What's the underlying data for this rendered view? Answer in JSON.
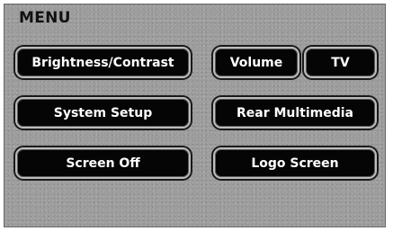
{
  "menu": {
    "title": "MENU"
  },
  "buttons": {
    "brightness_contrast": "Brightness/Contrast",
    "volume": "Volume",
    "tv": "TV",
    "system_setup": "System Setup",
    "rear_multimedia": "Rear Multimedia",
    "screen_off": "Screen Off",
    "logo_screen": "Logo Screen"
  },
  "colors": {
    "background": "#9c9c9c",
    "button_fill": "#050505",
    "button_text": "#ffffff",
    "button_border": "#bdbdbd",
    "title_text": "#111111"
  }
}
